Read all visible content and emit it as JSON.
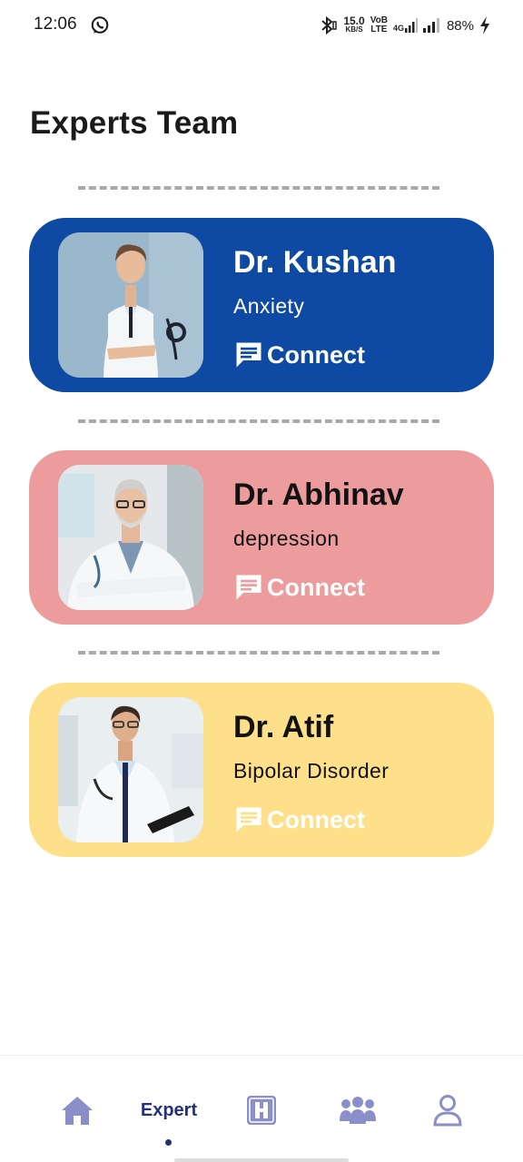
{
  "status_bar": {
    "time": "12:06",
    "net_speed_value": "15.0",
    "net_speed_unit": "KB/S",
    "volte_top": "VoB",
    "volte_bottom": "LTE",
    "net_type": "4G",
    "battery": "88%",
    "icons": [
      "whatsapp-icon",
      "bluetooth-icon",
      "signal-icon",
      "battery-charging-icon"
    ]
  },
  "page": {
    "title": "Experts Team"
  },
  "experts": [
    {
      "name": "Dr. Kushan",
      "specialty": "Anxiety",
      "connect_label": "Connect",
      "card_color": "#0e4aa4"
    },
    {
      "name": "Dr. Abhinav",
      "specialty": "depression",
      "connect_label": "Connect",
      "card_color": "#ec9c9d"
    },
    {
      "name": "Dr. Atif",
      "specialty": "Bipolar Disorder",
      "connect_label": "Connect",
      "card_color": "#ffe08a"
    }
  ],
  "bottom_nav": {
    "active_label": "Expert",
    "items": [
      "home-icon",
      "expert",
      "hospital-h-icon",
      "community-icon",
      "profile-icon"
    ],
    "accent_color": "#25307a",
    "icon_color": "#8a8fc9"
  }
}
